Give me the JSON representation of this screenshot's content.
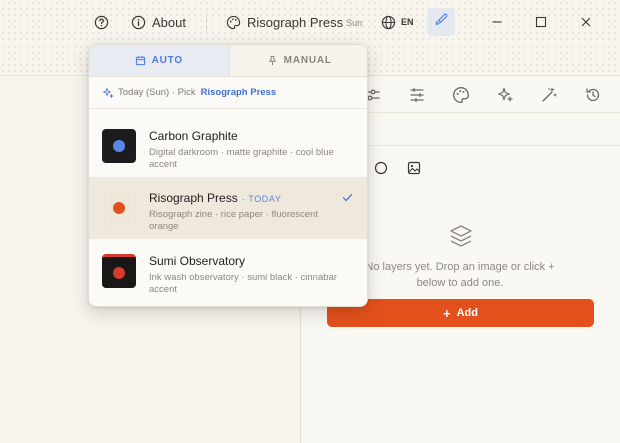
{
  "titlebar": {
    "about_label": "About",
    "theme_name": "Risograph Press",
    "theme_day": "Sun",
    "language": "EN"
  },
  "popover": {
    "tabs": [
      {
        "label": "AUTO",
        "active": true
      },
      {
        "label": "MANUAL",
        "active": false
      }
    ],
    "pick_prefix": "Today (Sun) · Pick",
    "pick_theme": "Risograph Press",
    "themes": [
      {
        "name": "Carbon Graphite",
        "description": "Digital darkroom · matte graphite · cool blue accent",
        "today_label": "",
        "swatch_bg": "#1c1c1e",
        "dot_color": "#5a86e8",
        "selected": false
      },
      {
        "name": "Risograph Press",
        "description": "Risograph zine · rice paper · fluorescent orange",
        "today_label": "· TODAY",
        "swatch_bg": "#efe7d7",
        "dot_color": "#e2511f",
        "selected": true
      },
      {
        "name": "Sumi Observatory",
        "description": "Ink wash observatory · sumi black · cinnabar accent",
        "today_label": "",
        "swatch_bg": "#1a1816",
        "dot_color": "#d63a2c",
        "selected": false
      }
    ]
  },
  "layers": {
    "empty_text": "No layers yet. Drop an image or click + below to add one.",
    "add_label": "Add"
  },
  "colors": {
    "accent_blue": "#4b7be0",
    "accent_orange": "#e4501c",
    "paper": "#f8f5ee"
  }
}
